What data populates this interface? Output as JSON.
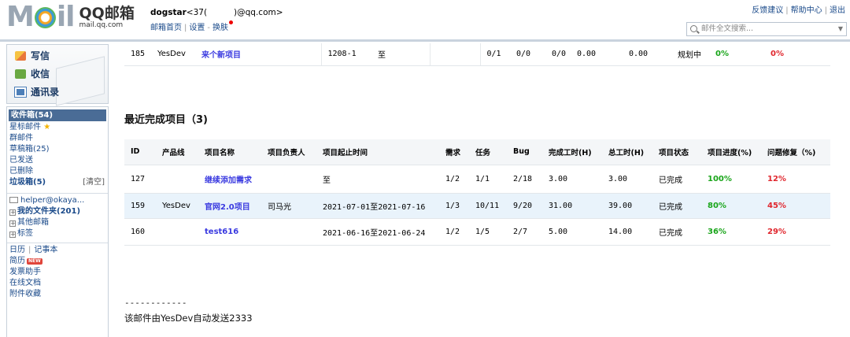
{
  "header": {
    "logo_text": "QQ邮箱",
    "logo_sub": "mail.qq.com",
    "user_name": "dogstar",
    "user_email_prefix": "<37(",
    "user_email_suffix": ")@qq.com>",
    "nav": [
      "邮箱首页",
      "设置",
      "换肤"
    ],
    "top_links": [
      "反馈建议",
      "帮助中心",
      "退出"
    ],
    "search_placeholder": "邮件全文搜索..."
  },
  "sidebar": {
    "quick": [
      "写信",
      "收信",
      "通讯录"
    ],
    "inbox": "收件箱(54)",
    "starred": "星标邮件",
    "group": "群邮件",
    "drafts": "草稿箱(25)",
    "sent": "已发送",
    "deleted": "已删除",
    "spam": "垃圾箱(5)",
    "spam_clear": "[清空]",
    "helper": "helper@okaya...",
    "my_folders": "我的文件夹(201)",
    "other_mail": "其他邮箱",
    "tags": "标签",
    "calendar": "日历",
    "notepad": "记事本",
    "resume": "简历",
    "new_badge": "NEW",
    "invoice": "发票助手",
    "docs": "在线文档",
    "attachments": "附件收藏"
  },
  "top_table": {
    "row": [
      "185",
      "YesDev",
      "来个新项目",
      "",
      "1208-1",
      "至",
      "",
      "0/1",
      "0/0",
      "0/0",
      "0.00",
      "0.00",
      "规划中",
      "0%",
      "0%"
    ]
  },
  "section": {
    "title": "最近完成项目（3)",
    "columns": [
      "ID",
      "产品线",
      "项目名称",
      "项目负责人",
      "项目起止时间",
      "需求",
      "任务",
      "Bug",
      "完成工时(H)",
      "总工时(H)",
      "项目状态",
      "项目进度(%)",
      "问题修复（%)"
    ],
    "rows": [
      [
        "127",
        "",
        "继续添加需求",
        "",
        "至",
        "1/2",
        "1/1",
        "2/18",
        "3.00",
        "3.00",
        "已完成",
        "100%",
        "12%"
      ],
      [
        "159",
        "YesDev",
        "官网2.0项目",
        "司马光",
        "2021-07-01至2021-07-16",
        "1/3",
        "10/11",
        "9/20",
        "31.00",
        "39.00",
        "已完成",
        "80%",
        "45%"
      ],
      [
        "160",
        "",
        "test616",
        "",
        "2021-06-16至2021-06-24",
        "1/2",
        "1/5",
        "2/7",
        "5.00",
        "14.00",
        "已完成",
        "36%",
        "29%"
      ]
    ]
  },
  "footer": {
    "dashes": "------------",
    "note": "该邮件由YesDev自动发送2333"
  }
}
